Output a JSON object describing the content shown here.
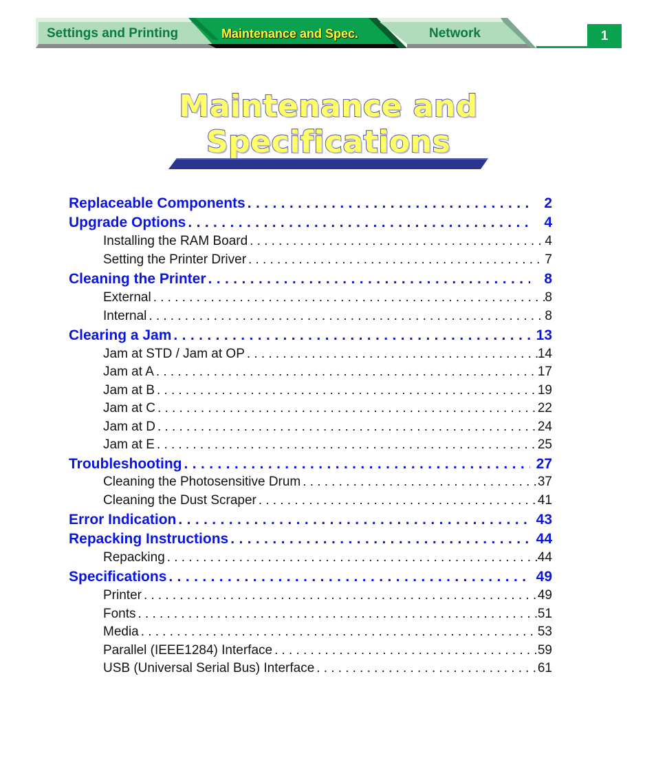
{
  "header": {
    "tabs": [
      {
        "label": "Settings and Printing",
        "active": false
      },
      {
        "label": "Maintenance and Spec.",
        "active": true
      },
      {
        "label": "Network",
        "active": false
      }
    ],
    "page_number": "1"
  },
  "title": {
    "line1": "Maintenance and",
    "line2": "Specifications"
  },
  "colors": {
    "tab_inactive_bg": "#b0dcbc",
    "tab_active_bg": "#0aa24e",
    "tab_active_text": "#ffff33",
    "tab_inactive_text": "#0b7a3a",
    "title_fill": "#ffff66",
    "title_outline": "#5050a8",
    "title_bar": "#2b3590",
    "toc_main": "#0a14e0",
    "toc_sub": "#111111"
  },
  "toc": [
    {
      "title": "Replaceable Components",
      "page": "2",
      "level": "main"
    },
    {
      "title": "Upgrade Options",
      "page": "4",
      "level": "main"
    },
    {
      "title": "Installing the RAM Board",
      "page": "4",
      "level": "sub"
    },
    {
      "title": "Setting the Printer Driver",
      "page": "7",
      "level": "sub"
    },
    {
      "title": "Cleaning the Printer",
      "page": "8",
      "level": "main"
    },
    {
      "title": "External",
      "page": "8",
      "level": "sub"
    },
    {
      "title": "Internal",
      "page": "8",
      "level": "sub"
    },
    {
      "title": "Clearing a Jam",
      "page": "13",
      "level": "main"
    },
    {
      "title": "Jam at STD / Jam at OP",
      "page": "14",
      "level": "sub"
    },
    {
      "title": "Jam at A",
      "page": "17",
      "level": "sub"
    },
    {
      "title": "Jam at B",
      "page": "19",
      "level": "sub"
    },
    {
      "title": "Jam at C",
      "page": "22",
      "level": "sub"
    },
    {
      "title": "Jam at D",
      "page": "24",
      "level": "sub"
    },
    {
      "title": "Jam at E",
      "page": "25",
      "level": "sub"
    },
    {
      "title": "Troubleshooting",
      "page": "27",
      "level": "main"
    },
    {
      "title": "Cleaning the Photosensitive Drum",
      "page": "37",
      "level": "sub"
    },
    {
      "title": "Cleaning the Dust Scraper",
      "page": "41",
      "level": "sub"
    },
    {
      "title": "Error Indication",
      "page": "43",
      "level": "main"
    },
    {
      "title": "Repacking Instructions",
      "page": "44",
      "level": "main"
    },
    {
      "title": "Repacking",
      "page": "44",
      "level": "sub"
    },
    {
      "title": "Specifications",
      "page": "49",
      "level": "main"
    },
    {
      "title": "Printer",
      "page": "49",
      "level": "sub"
    },
    {
      "title": "Fonts",
      "page": "51",
      "level": "sub"
    },
    {
      "title": "Media",
      "page": "53",
      "level": "sub"
    },
    {
      "title": "Parallel (IEEE1284) Interface",
      "page": "59",
      "level": "sub"
    },
    {
      "title": "USB (Universal Serial Bus) Interface",
      "page": "61",
      "level": "sub"
    }
  ]
}
